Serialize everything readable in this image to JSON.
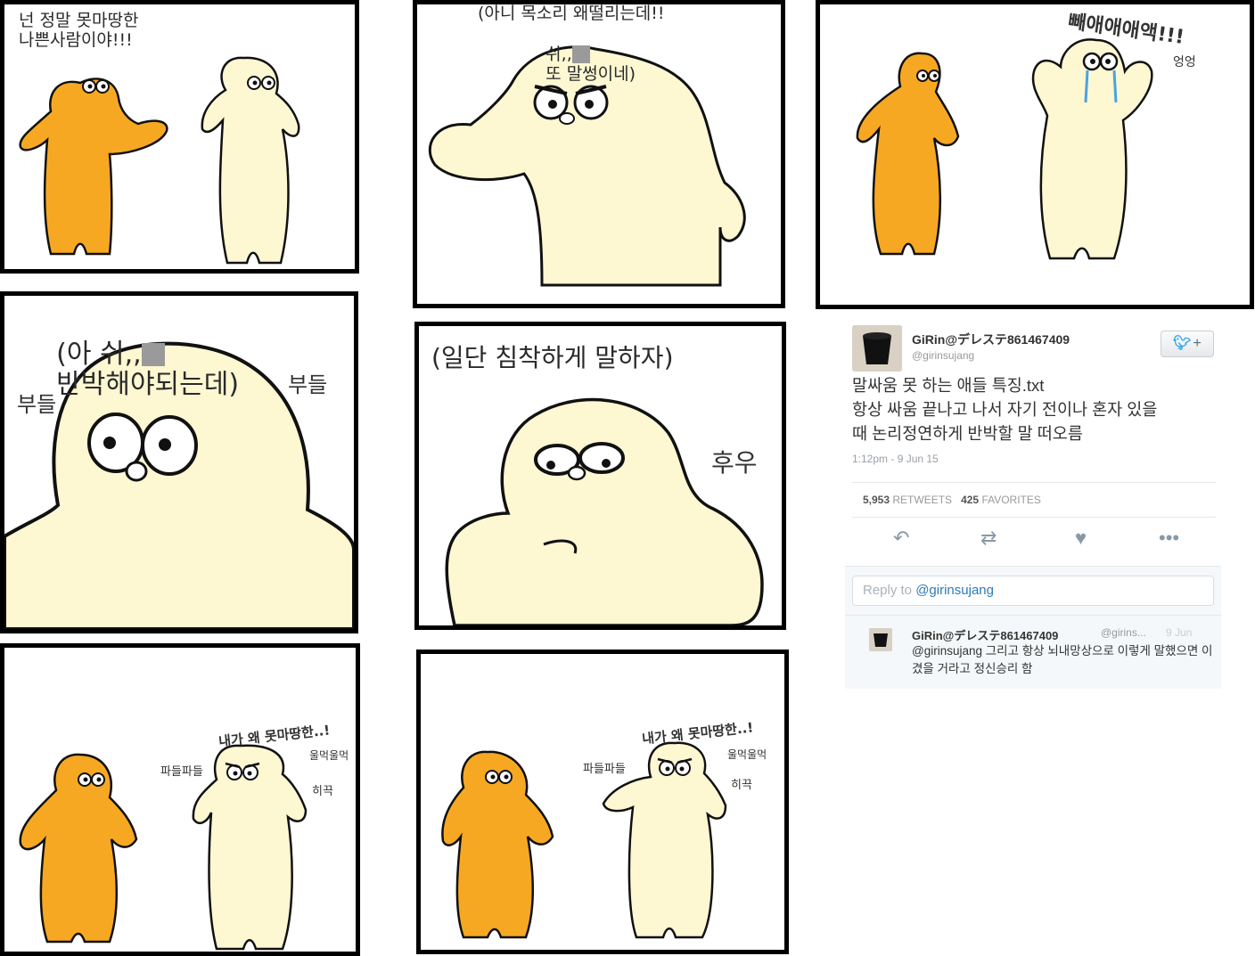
{
  "panels": {
    "p1": {
      "caption": "넌 정말 못마땅한\n나쁜사람이야!!!"
    },
    "p2": {
      "caption_line1": "(아니 목소리 왜떨리는데!!",
      "caption_line2_a": "쉬,,",
      "caption_line2_b": "또 말썽이네)"
    },
    "p3": {
      "shout": "빼애애애액!!!",
      "cry": "엉엉"
    },
    "p4": {
      "caption_a": "(아 쉬,,",
      "caption_b": "반박해야되는데)",
      "left_sfx": "부들",
      "right_sfx": "부들"
    },
    "p5": {
      "caption": "(일단 침착하게 말하자)",
      "sfx": "후우"
    },
    "p6": {
      "speech": "내가 왜 못마땅한..!",
      "tremble": "파들파들",
      "sob": "울먹울먹",
      "hiccup": "히끅"
    },
    "p7": {
      "speech": "내가 왜 못마땅한..!",
      "tremble": "파들파들",
      "sob": "울먹울먹",
      "hiccup": "히끅"
    }
  },
  "tweet": {
    "name": "GiRin@デレステ861467409",
    "handle": "@girinsujang",
    "follow_icon": "twitter-bird-icon",
    "follow_plus": "+",
    "text_line1": "말싸움 못 하는 애들 특징.txt",
    "text_line2": "항상 싸움 끝나고 나서 자기 전이나 혼자 있을",
    "text_line3": "때 논리정연하게 반박할 말 떠오름",
    "timestamp": "1:12pm - 9 Jun 15",
    "retweets_count": "5,953",
    "retweets_label": "RETWEETS",
    "favorites_count": "425",
    "favorites_label": "FAVORITES",
    "reply_placeholder_prefix": "Reply to ",
    "reply_placeholder_handle": "@girinsujang",
    "reply": {
      "name": "GiRin@デレステ861467409",
      "handle": "@girins...",
      "date": "9 Jun",
      "text": "@girinsujang 그리고 항상 뇌내망상으로 이렇게 말했으면 이겼을 거라고 정신승리 함"
    }
  },
  "colors": {
    "orange": "#F7A823",
    "cream": "#FDF7D2",
    "outline": "#111111",
    "twitter_blue": "#2AA3EF"
  }
}
